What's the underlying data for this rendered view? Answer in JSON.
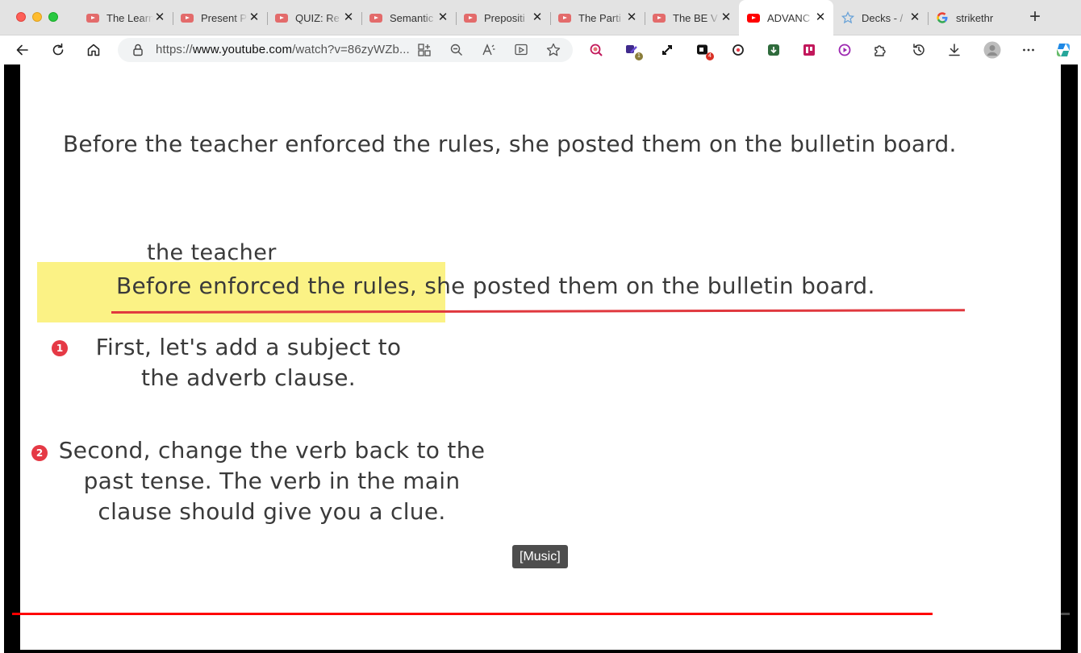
{
  "browser": {
    "tabs": [
      {
        "title": "The Learn",
        "favicon": "youtube-icon",
        "active": false
      },
      {
        "title": "Present P",
        "favicon": "youtube-icon",
        "active": false
      },
      {
        "title": "QUIZ: Re",
        "favicon": "youtube-icon",
        "active": false
      },
      {
        "title": "Semantic",
        "favicon": "youtube-icon",
        "active": false
      },
      {
        "title": "Prepositi",
        "favicon": "youtube-icon",
        "active": false
      },
      {
        "title": "The Parti",
        "favicon": "youtube-icon",
        "active": false
      },
      {
        "title": "The BE V",
        "favicon": "youtube-icon",
        "active": false
      },
      {
        "title": "ADVANC",
        "favicon": "youtube-icon",
        "active": true
      },
      {
        "title": "Decks - /",
        "favicon": "star-icon",
        "active": false
      },
      {
        "title": "strikethr",
        "favicon": "google-icon",
        "active": false
      }
    ],
    "url_prefix": "https://",
    "url_domain": "www.youtube.com",
    "url_rest": "/watch?v=86zyWZb...",
    "extension_badges": {
      "first": "1",
      "second": "4"
    }
  },
  "slide": {
    "sentence_original": "Before the teacher enforced the rules, she posted them on the bulletin board.",
    "inserted_subject": "the teacher",
    "sentence_edited_part1": "Before enforced",
    "sentence_edited_part2": " the rules",
    "sentence_edited_part3": ", she posted them on the bulletin board.",
    "steps": [
      {
        "number": "1",
        "text": "First, let's add a subject to\nthe adverb clause."
      },
      {
        "number": "2",
        "text": "Second, change the verb back to the\npast tense. The verb in the main\nclause should give you a clue."
      }
    ]
  },
  "player": {
    "caption": "[Music]",
    "progress": 0.87
  },
  "colors": {
    "highlight": "#fbf285",
    "underline": "#e0383e",
    "step_badge": "#e53945",
    "progress": "#ff0000"
  }
}
